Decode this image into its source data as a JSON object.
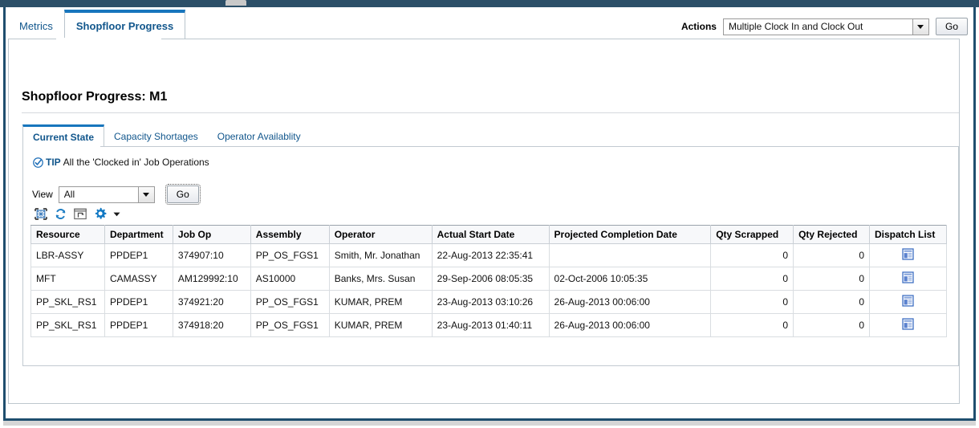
{
  "window": {
    "chrome_bar_color": "#2c4f68",
    "frame_border_color": "#1f4e6e"
  },
  "primary_tabs": [
    {
      "label": "Metrics",
      "active": false
    },
    {
      "label": "Shopfloor Progress",
      "active": true
    }
  ],
  "actions": {
    "label": "Actions",
    "selected": "Multiple Clock In and Clock Out",
    "go_label": "Go"
  },
  "page_title": "Shopfloor Progress: M1",
  "sub_tabs": [
    {
      "label": "Current State",
      "active": true
    },
    {
      "label": "Capacity Shortages",
      "active": false
    },
    {
      "label": "Operator Availablity",
      "active": false
    }
  ],
  "tip": {
    "icon": "check-circle-icon",
    "label": "TIP",
    "text": "All the 'Clocked in' Job Operations"
  },
  "view": {
    "label": "View",
    "selected": "All",
    "go_label": "Go"
  },
  "toolbar_icons": [
    {
      "name": "select-all-icon"
    },
    {
      "name": "refresh-icon"
    },
    {
      "name": "detach-icon"
    },
    {
      "name": "gear-icon"
    },
    {
      "name": "chevron-down-icon"
    }
  ],
  "table": {
    "columns": [
      {
        "label": "Resource",
        "align": "left"
      },
      {
        "label": "Department",
        "align": "left"
      },
      {
        "label": "Job Op",
        "align": "left"
      },
      {
        "label": "Assembly",
        "align": "left"
      },
      {
        "label": "Operator",
        "align": "left"
      },
      {
        "label": "Actual Start Date",
        "align": "left"
      },
      {
        "label": "Projected Completion Date",
        "align": "left"
      },
      {
        "label": "Qty Scrapped",
        "align": "right"
      },
      {
        "label": "Qty Rejected",
        "align": "right"
      },
      {
        "label": "Dispatch List",
        "align": "center"
      }
    ],
    "rows": [
      {
        "resource": "LBR-ASSY",
        "department": "PPDEP1",
        "job_op": "374907:10",
        "assembly": "PP_OS_FGS1",
        "operator": "Smith, Mr. Jonathan",
        "actual_start_date": "22-Aug-2013 22:35:41",
        "projected_completion_date": "",
        "qty_scrapped": "0",
        "qty_rejected": "0",
        "dispatch_icon": "dispatch-list-icon"
      },
      {
        "resource": "MFT",
        "department": "CAMASSY",
        "job_op": "AM129992:10",
        "assembly": "AS10000",
        "operator": "Banks, Mrs. Susan",
        "actual_start_date": "29-Sep-2006 08:05:35",
        "projected_completion_date": "02-Oct-2006 10:05:35",
        "qty_scrapped": "0",
        "qty_rejected": "0",
        "dispatch_icon": "dispatch-list-icon"
      },
      {
        "resource": "PP_SKL_RS1",
        "department": "PPDEP1",
        "job_op": "374921:20",
        "assembly": "PP_OS_FGS1",
        "operator": "KUMAR, PREM",
        "actual_start_date": "23-Aug-2013 03:10:26",
        "projected_completion_date": "26-Aug-2013 00:06:00",
        "qty_scrapped": "0",
        "qty_rejected": "0",
        "dispatch_icon": "dispatch-list-icon"
      },
      {
        "resource": "PP_SKL_RS1",
        "department": "PPDEP1",
        "job_op": "374918:20",
        "assembly": "PP_OS_FGS1",
        "operator": "KUMAR, PREM",
        "actual_start_date": "23-Aug-2013 01:40:11",
        "projected_completion_date": "26-Aug-2013 00:06:00",
        "qty_scrapped": "0",
        "qty_rejected": "0",
        "dispatch_icon": "dispatch-list-icon"
      }
    ]
  },
  "colors": {
    "accent_blue": "#1876bd",
    "link_blue": "#11568c",
    "chrome_navy": "#2c4f68"
  }
}
